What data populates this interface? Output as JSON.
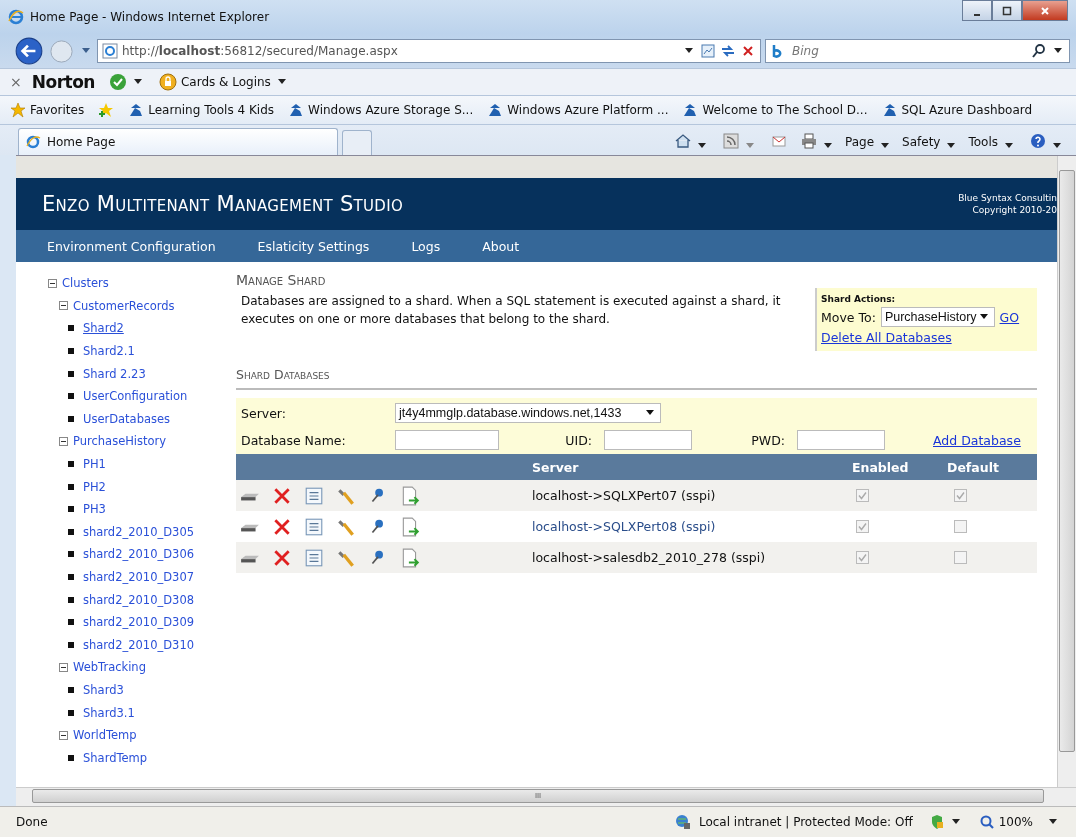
{
  "window": {
    "title": "Home Page - Windows Internet Explorer"
  },
  "address_bar": {
    "url": "http://**localhost**:56812/secured/Manage.aspx"
  },
  "search": {
    "placeholder": "Bing"
  },
  "norton_bar": {
    "close": "×",
    "brand": "Norton",
    "cards": "Cards & Logins"
  },
  "favorites_bar": {
    "label": "Favorites",
    "items": [
      "Learning Tools 4 Kids",
      "Windows Azure Storage S...",
      "Windows Azure Platform ...",
      "Welcome to The School D...",
      "SQL Azure Dashboard"
    ]
  },
  "tabs": [
    {
      "label": "Home Page",
      "selected": true
    }
  ],
  "command_bar": [
    "Page",
    "Safety",
    "Tools"
  ],
  "page": {
    "title": "Enzo Multitenant Management Studio",
    "company": "Blue Syntax Consultin",
    "copyright": "Copyright 2010-20",
    "nav": [
      "Environment Configuration",
      "Eslaticity Settings",
      "Logs",
      "About"
    ],
    "tree": [
      {
        "label": "Clusters",
        "expanded": true,
        "children": [
          {
            "label": "CustomerRecords",
            "expanded": true,
            "children": [
              {
                "label": "Shard2",
                "selected": true
              },
              {
                "label": "Shard2.1",
                "selected": false
              },
              {
                "label": "Shard 2.23",
                "selected": false
              },
              {
                "label": "UserConfiguration",
                "selected": false
              },
              {
                "label": "UserDatabases",
                "selected": false
              }
            ]
          },
          {
            "label": "PurchaseHistory",
            "expanded": true,
            "children": [
              {
                "label": "PH1",
                "selected": false
              },
              {
                "label": "PH2",
                "selected": false
              },
              {
                "label": "PH3",
                "selected": false
              },
              {
                "label": "shard2_2010_D305",
                "selected": false
              },
              {
                "label": "shard2_2010_D306",
                "selected": false
              },
              {
                "label": "shard2_2010_D307",
                "selected": false
              },
              {
                "label": "shard2_2010_D308",
                "selected": false
              },
              {
                "label": "shard2_2010_D309",
                "selected": false
              },
              {
                "label": "shard2_2010_D310",
                "selected": false
              }
            ]
          },
          {
            "label": "WebTracking",
            "expanded": true,
            "children": [
              {
                "label": "Shard3",
                "selected": false
              },
              {
                "label": "Shard3.1",
                "selected": false
              }
            ]
          },
          {
            "label": "WorldTemp",
            "expanded": true,
            "children": [
              {
                "label": "ShardTemp",
                "selected": false
              }
            ]
          }
        ]
      }
    ],
    "section_title": "Manage Shard",
    "description": "Databases are assigned to a shard. When a SQL statement is executed against a shard, it executes on one or more databases that belong to the shard.",
    "actions": {
      "title": "Shard Actions:",
      "move_label": "Move To:",
      "move_value": "PurchaseHistory",
      "go": "GO",
      "delete_all": "Delete All Databases"
    },
    "databases_title": "Shard Databases",
    "form": {
      "server_label": "Server:",
      "server_value": "jt4y4mmglp.database.windows.net,1433",
      "db_label": "Database Name:",
      "uid_label": "UID:",
      "pwd_label": "PWD:",
      "add": "Add Database"
    },
    "table": {
      "columns": [
        "Server",
        "Enabled",
        "Default"
      ],
      "rows": [
        {
          "server": "localhost->SQLXPert07 (sspi)",
          "enabled": true,
          "default": true,
          "hover": false
        },
        {
          "server": "localhost->SQLXPert08 (sspi)",
          "enabled": true,
          "default": false,
          "hover": true
        },
        {
          "server": "localhost->salesdb2_2010_278 (sspi)",
          "enabled": true,
          "default": false,
          "hover": false
        }
      ]
    }
  },
  "status_bar": {
    "status": "Done",
    "zone": "Local intranet | Protected Mode: Off",
    "zoom": "100%",
    "scroll_grip": "III"
  }
}
